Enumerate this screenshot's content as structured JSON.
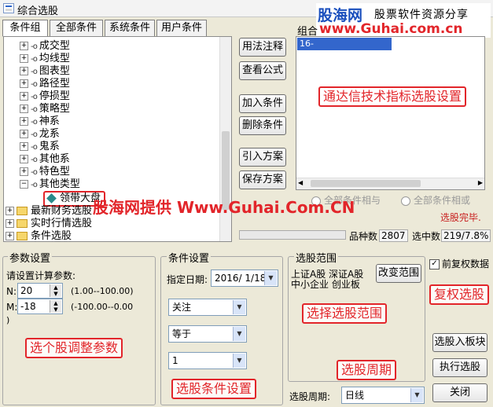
{
  "window": {
    "title": "综合选股"
  },
  "watermark_top": {
    "brand": "股海网",
    "slogan": "股票软件资源分享",
    "url": "www.Guhai.com.cn"
  },
  "tabs": [
    "条件组",
    "全部条件",
    "系统条件",
    "用户条件"
  ],
  "tree": {
    "items": [
      "成交型",
      "均线型",
      "图表型",
      "路径型",
      "停损型",
      "策略型",
      "神系",
      "龙系",
      "鬼系",
      "其他系",
      "特色型",
      "其他类型",
      "领带大盘"
    ],
    "folders": [
      "最新财务选股",
      "实时行情选股",
      "条件选股"
    ]
  },
  "middle_buttons": [
    "用法注释",
    "查看公式",
    "加入条件",
    "删除条件",
    "引入方案",
    "保存方案"
  ],
  "combo": {
    "label": "组合",
    "list_item": "16-"
  },
  "radios": {
    "and": "全部条件相与",
    "or": "全部条件相或"
  },
  "status": {
    "done": "选股完毕.",
    "count_label": "品种数",
    "count_value": "2807",
    "hit_label": "选中数",
    "hit_value": "219/7.8%"
  },
  "params": {
    "group_title": "参数设置",
    "prompt": "请设置计算参数:",
    "n_label": "N:",
    "n_value": "20",
    "n_range": "(1.00--100.00)",
    "m_label": "M:",
    "m_value": "-18",
    "m_range": "(-100.00--0.00",
    "tail": ")"
  },
  "conditions": {
    "group_title": "条件设置",
    "date_label": "指定日期:",
    "date_value": "2016/ 1/18",
    "select1": "关注",
    "select2": "等于",
    "select3": "1"
  },
  "range": {
    "group_title": "选股范围",
    "line1": "上证A股 深证A股",
    "line2": "中小企业 创业板",
    "change_button": "改变范围",
    "period_label": "选股周期:",
    "period_value": "日线"
  },
  "right_panel": {
    "checkbox": "前复权数据",
    "add_board": "选股入板块",
    "execute": "执行选股",
    "close": "关闭"
  },
  "annotations": {
    "tdx": "通达信技术指标选股设置",
    "provided": "股海网提供 Www.Guhai.Com.CN",
    "restore": "复权选股",
    "choose_range": "选择选股范围",
    "period": "选股周期",
    "adjust": "选个股调整参数",
    "cond": "选股条件设置"
  },
  "colors": {
    "annotation": "#e2252a",
    "selected": "#3366cc",
    "brand_blue": "#1a4fbd"
  }
}
